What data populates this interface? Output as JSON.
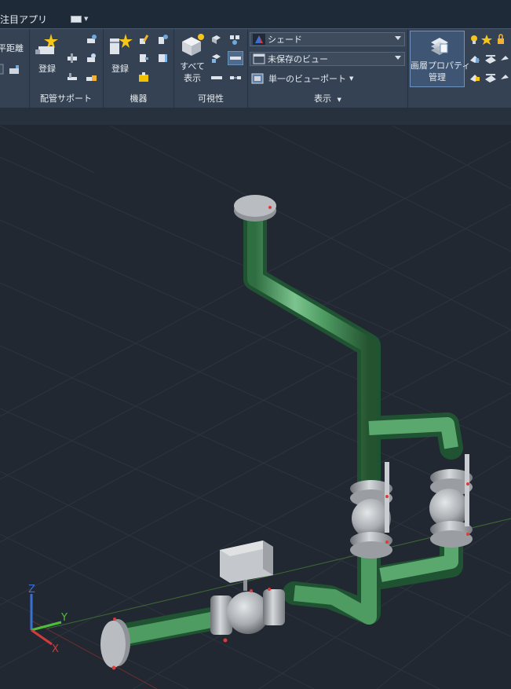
{
  "tabs": [
    "注目アプリ"
  ],
  "tab_button_label": "",
  "ribbon": {
    "measure": {
      "label_partial": "水平距離"
    },
    "pipe_support": {
      "register_label": "登録",
      "panel_label": "配管サポート"
    },
    "equipment": {
      "register_label": "登録",
      "panel_label": "機器"
    },
    "visibility": {
      "show_all_label": "すべて\n表示",
      "show_all_line1": "すべて",
      "show_all_line2": "表示",
      "panel_label": "可視性"
    },
    "view": {
      "visual_style": "シェード",
      "named_view": "未保存のビュー",
      "viewport_config": "単一のビューポート",
      "panel_label": "表示"
    },
    "layers": {
      "layer_props_line1": "画層プロパティ",
      "layer_props_line2": "管理"
    }
  },
  "ucs": {
    "x_label": "X",
    "y_label": "Y",
    "z_label": "Z"
  },
  "colors": {
    "ribbon_bg": "#354253",
    "viewport_bg": "#212831",
    "pipe_green": "#4f9c63",
    "pipe_glow": "#1f5a32",
    "metal": "#a9adb1",
    "axis_x": "#d43a3a",
    "axis_y": "#4fbf3a",
    "axis_z": "#3a6fd4",
    "accent_blue": "#6fa8dc"
  }
}
